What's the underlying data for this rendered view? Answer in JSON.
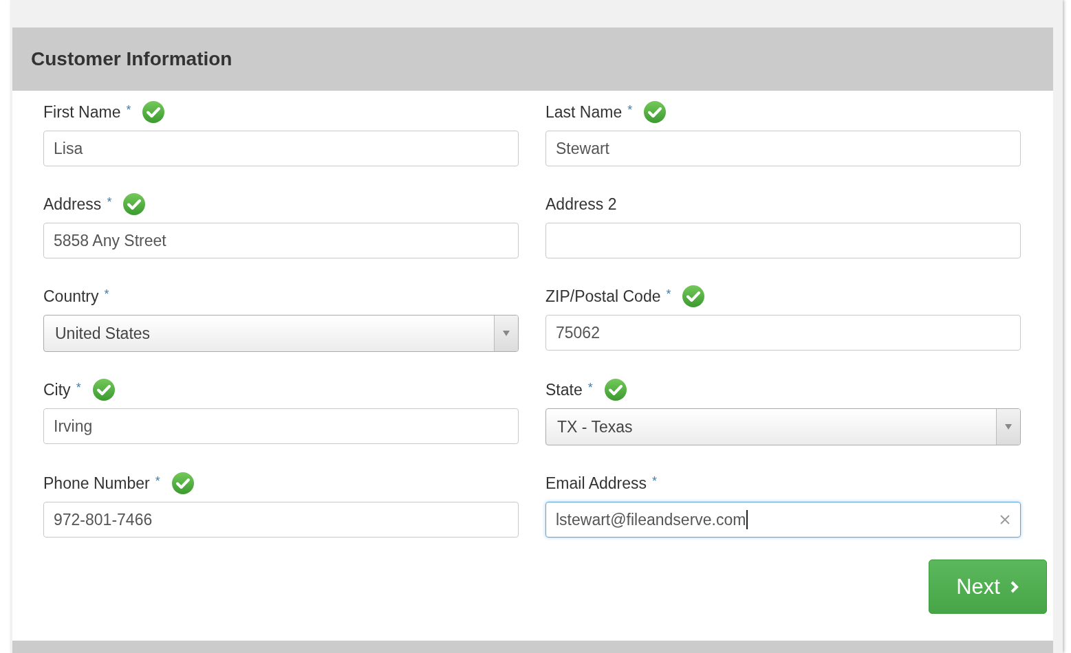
{
  "panel": {
    "title": "Customer Information"
  },
  "fields": [
    {
      "label": "First Name",
      "required_mark": "*",
      "valid": true,
      "kind": "text",
      "value": "Lisa"
    },
    {
      "label": "Last Name",
      "required_mark": "*",
      "valid": true,
      "kind": "text",
      "value": "Stewart"
    },
    {
      "label": "Address",
      "required_mark": "*",
      "valid": true,
      "kind": "text",
      "value": "5858 Any Street"
    },
    {
      "label": "Address 2",
      "valid": false,
      "kind": "text"
    },
    {
      "label": "Country",
      "required_mark": "*",
      "valid": false,
      "kind": "select",
      "value": "United States"
    },
    {
      "label": "ZIP/Postal Code",
      "required_mark": "*",
      "valid": true,
      "kind": "text",
      "value": "75062"
    },
    {
      "label": "City",
      "required_mark": "*",
      "valid": true,
      "kind": "text",
      "value": "Irving"
    },
    {
      "label": "State",
      "required_mark": "*",
      "valid": true,
      "kind": "select",
      "value": "TX - Texas"
    },
    {
      "label": "Phone Number",
      "required_mark": "*",
      "valid": true,
      "kind": "text",
      "value": "972-801-7466"
    },
    {
      "label": "Email Address",
      "required_mark": "*",
      "valid": false,
      "kind": "text",
      "value": "lstewart@fileandserve.com",
      "focused": true
    }
  ],
  "next_button": {
    "label": "Next"
  }
}
